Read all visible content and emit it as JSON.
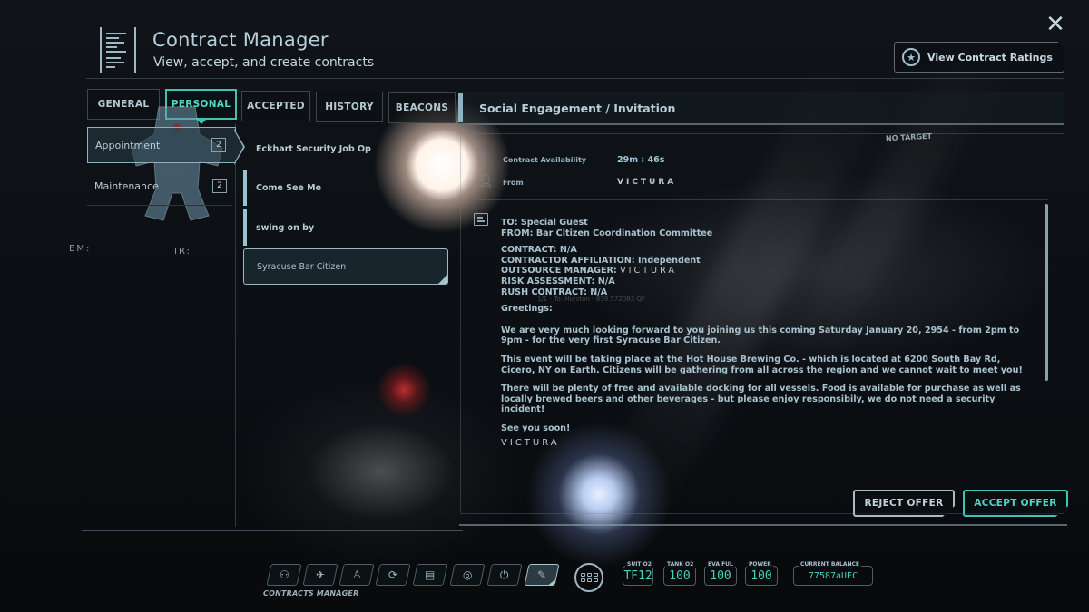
{
  "header": {
    "title": "Contract Manager",
    "subtitle": "View, accept, and create contracts",
    "ratings_button": "View Contract Ratings",
    "close_icon": "close-icon"
  },
  "tabs": [
    {
      "label": "GENERAL",
      "active": false
    },
    {
      "label": "PERSONAL",
      "active": true
    },
    {
      "label": "ACCEPTED",
      "active": false
    },
    {
      "label": "HISTORY",
      "active": false
    },
    {
      "label": "BEACONS",
      "active": false
    }
  ],
  "categories": [
    {
      "label": "Appointment",
      "count": "2",
      "active": true
    },
    {
      "label": "Maintenance",
      "count": "2",
      "active": false
    }
  ],
  "signature": {
    "em_label": "EM:",
    "ir_label": "IR:"
  },
  "contracts": [
    {
      "title": "Eckhart Security Job Op",
      "selected": false
    },
    {
      "title": "Come See Me",
      "selected": false
    },
    {
      "title": "swing on by",
      "selected": false
    },
    {
      "title": "Syracuse Bar Citizen",
      "selected": true
    }
  ],
  "detail": {
    "category_title": "Social Engagement / Invitation",
    "no_target": "NO TARGET",
    "availability_label": "Contract Availability",
    "availability_value": "29m : 46s",
    "from_label": "From",
    "from_value": "VICTURA",
    "ghost_text": "1/1 - To: Hurston - 839.572083 QF",
    "message": {
      "to": "TO: Special Guest",
      "from": "FROM: Bar Citizen Coordination Committee",
      "contract": "CONTRACT: N/A",
      "affiliation": "CONTRACTOR AFFILIATION: Independent",
      "manager_label": "OUTSOURCE MANAGER:",
      "manager_value": "VICTURA",
      "risk": "RISK ASSESSMENT: N/A",
      "rush": "RUSH CONTRACT: N/A",
      "greeting": "Greetings:",
      "para1": "We are very much looking forward to you joining us this coming Saturday January 20, 2954 - from 2pm to 9pm - for the very first Syracuse Bar Citizen.",
      "para2": "This event will be taking place at the Hot House Brewing Co. - which is located at 6200 South Bay Rd, Cicero, NY on Earth. Citizens will be gathering from all across the region and we cannot wait to meet you!",
      "para3": "There will be plenty of free and available docking for all vessels. Food is available for purchase as well as locally brewed beers and other beverages - but please enjoy responsibily, we do not need a security incident!",
      "closing": "See you soon!",
      "signature": "VICTURA"
    },
    "reject_button": "REJECT OFFER",
    "accept_button": "ACCEPT OFFER"
  },
  "hud": {
    "apps": [
      {
        "icon": "party-icon",
        "glyph": "⚇"
      },
      {
        "icon": "ship-icon",
        "glyph": "✈"
      },
      {
        "icon": "character-icon",
        "glyph": "♙"
      },
      {
        "icon": "refresh-icon",
        "glyph": "⟳"
      },
      {
        "icon": "inventory-icon",
        "glyph": "▤"
      },
      {
        "icon": "starmap-icon",
        "glyph": "◎"
      },
      {
        "icon": "power-icon",
        "glyph": "⏻"
      },
      {
        "icon": "contracts-icon",
        "glyph": "✎",
        "active": true
      }
    ],
    "active_app_label": "CONTRACTS MANAGER",
    "stats": [
      {
        "label": "SUIT O2",
        "value": "TF12"
      },
      {
        "label": "TANK O2",
        "value": "100"
      },
      {
        "label": "EVA FUL",
        "value": "100"
      },
      {
        "label": "POWER",
        "value": "100"
      },
      {
        "label": "CURRENT BALANCE",
        "value": "77587aUEC"
      }
    ]
  },
  "colors": {
    "accent": "#3fc3b3",
    "text": "#a9c4d0",
    "stat_value": "#45d0c0"
  }
}
